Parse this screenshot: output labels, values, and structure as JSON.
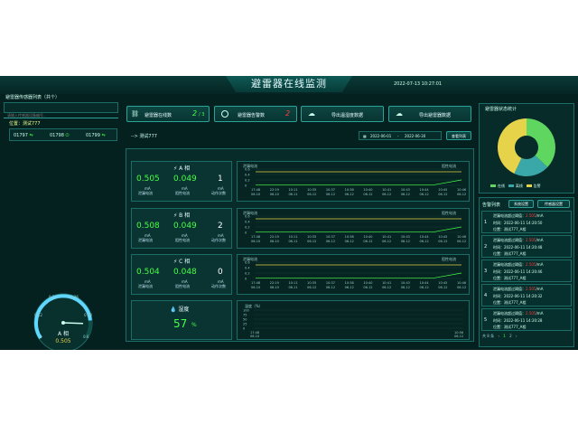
{
  "header": {
    "title": "避雷器在线监测",
    "datetime": "2022-07-13 10:27:01"
  },
  "left": {
    "list_title": "避雷器传感器列表（共个）",
    "search_placeholder": "请输入传感器设备编号...",
    "location_label": "位置：测试777",
    "devices": [
      {
        "id": "01797",
        "icon": "signal-icon"
      },
      {
        "id": "01798",
        "icon": "power-icon"
      },
      {
        "id": "01799",
        "icon": "signal-icon"
      }
    ],
    "gauge": {
      "phase_label": "A 相",
      "value": "0.505",
      "ticks": [
        "0",
        "0.12",
        "0.24",
        "0.36",
        "0.48",
        "0.6"
      ],
      "fraction": 0.84
    }
  },
  "top_buttons": {
    "online": {
      "label": "避雷器在线数",
      "count": "2",
      "total": "/ 3"
    },
    "alarm": {
      "label": "避雷器告警数",
      "count": "2"
    },
    "export_temp": {
      "label": "导出温湿度数据"
    },
    "export_arrester": {
      "label": "导出避雷器数据"
    }
  },
  "breadcrumb": "--> 测试777",
  "date_range": {
    "start": "2022-06-01",
    "sep": "-",
    "end": "2022-06-30",
    "button": "查看列表"
  },
  "phases": [
    {
      "name": "A 相",
      "leak": "0.505",
      "resist": "0.049",
      "count": "1",
      "unit": "mA",
      "leak_label": "泄漏电流",
      "resist_label": "阻性电流",
      "count_label": "动作次数"
    },
    {
      "name": "B 相",
      "leak": "0.508",
      "resist": "0.049",
      "count": "2",
      "unit": "mA",
      "leak_label": "泄漏电流",
      "resist_label": "阻性电流",
      "count_label": "动作次数"
    },
    {
      "name": "C 相",
      "leak": "0.504",
      "resist": "0.048",
      "count": "0",
      "unit": "mA",
      "leak_label": "泄漏电流",
      "resist_label": "阻性电流",
      "count_label": "动作次数"
    }
  ],
  "humidity": {
    "label": "湿度",
    "value": "57",
    "unit": "%"
  },
  "charts": {
    "left_legend": "泄漏电流",
    "right_legend": "阻性电流",
    "y_ticks": [
      "0.6",
      "0.4",
      "0.2",
      "0"
    ],
    "x_labels": [
      [
        "17:48",
        "06-10"
      ],
      [
        "22:19",
        "06-10"
      ],
      [
        "10:11",
        "06-11"
      ],
      [
        "10:35",
        "06-12"
      ],
      [
        "10:37",
        "06-12"
      ],
      [
        "10:38",
        "06-12"
      ],
      [
        "10:40",
        "06-12"
      ],
      [
        "10:41",
        "06-12"
      ],
      [
        "10:43",
        "06-12"
      ],
      [
        "10:44",
        "06-12"
      ],
      [
        "10:45",
        "06-12"
      ],
      [
        "10:46",
        "06-12"
      ]
    ],
    "humidity_title": "湿度（%）",
    "humidity_y_ticks": [
      "100",
      "75",
      "50",
      "25",
      "0"
    ],
    "humidity_x_start": [
      "17:48",
      "06-10"
    ],
    "humidity_x_end": [
      "10:56",
      "06-12"
    ]
  },
  "pie": {
    "title": "避雷器状态统计",
    "legend": [
      {
        "label": "在线",
        "color": "#5fd65f"
      },
      {
        "label": "离线",
        "color": "#3aa8a8"
      },
      {
        "label": "告警",
        "color": "#e6d34a"
      }
    ],
    "values": [
      37,
      20,
      43
    ]
  },
  "alarms": {
    "title": "告警列表",
    "tab1": "系统设置",
    "tab2": "传感器设置",
    "items": [
      {
        "n": "1",
        "msg": "泄漏电流超过阈值：",
        "value": "2.505",
        "unit": "/mA",
        "time": "时间：2022-06-11 14:20:50",
        "loc": "位置：测试777_A相"
      },
      {
        "n": "2",
        "msg": "泄漏电流超过阈值：",
        "value": "2.505",
        "unit": "/mA",
        "time": "时间：2022-06-11 14:20:48",
        "loc": "位置：测试777_A相"
      },
      {
        "n": "3",
        "msg": "泄漏电流超过阈值：",
        "value": "2.505",
        "unit": "/mA",
        "time": "时间：2022-06-11 14:20:46",
        "loc": "位置：测试777_A相"
      },
      {
        "n": "4",
        "msg": "泄漏电流超过阈值：",
        "value": "2.505",
        "unit": "/mA",
        "time": "时间：2022-06-11 14:20:32",
        "loc": "位置：测试777_A相"
      },
      {
        "n": "5",
        "msg": "泄漏电流超过阈值：",
        "value": "2.505",
        "unit": "/mA",
        "time": "时间：2022-06-11 14:20:28",
        "loc": "位置：测试777_A相"
      }
    ],
    "pager": {
      "total": "共 8 条",
      "prev": "‹",
      "p1": "1",
      "p2": "2",
      "next": "›"
    }
  },
  "colors": {
    "accent": "#2aa39a",
    "green": "#46ff46",
    "red": "#ff3b3b",
    "yellow": "#e6d34a"
  }
}
